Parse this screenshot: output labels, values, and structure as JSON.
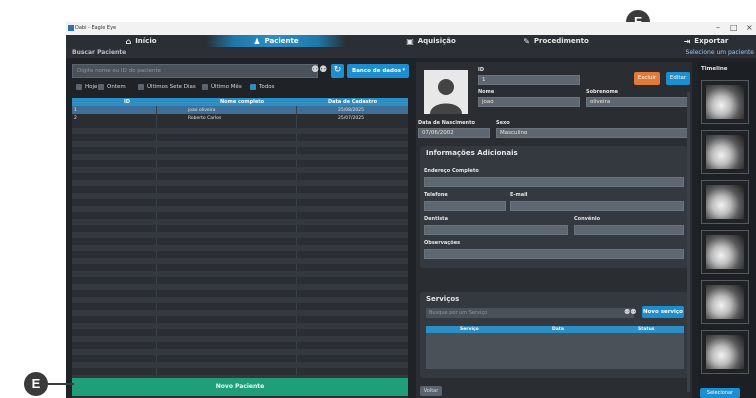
{
  "window": {
    "title": "Dabi - Eagle Eye",
    "min_glyph": "–",
    "max_glyph": "□",
    "close_glyph": "×"
  },
  "nav": {
    "tabs": [
      {
        "label": "Início",
        "icon": "home-icon"
      },
      {
        "label": "Paciente",
        "icon": "person-icon",
        "active": true
      },
      {
        "label": "Aquisição",
        "icon": "acquisition-icon"
      },
      {
        "label": "Procedimento",
        "icon": "edit-icon"
      },
      {
        "label": "Exportar",
        "icon": "export-icon"
      }
    ],
    "icons": {
      "home": "⌂",
      "person": "♟",
      "acquisition": "▣",
      "edit": "✎",
      "export": "⇥"
    }
  },
  "subheader": {
    "left": "Buscar Paciente",
    "right": "Selecione um paciente"
  },
  "search": {
    "placeholder": "Digite nome ou ID do paciente",
    "binoculars_glyph": "⚉⚉",
    "refresh_glyph": "↻",
    "db_label": "Banco de dados",
    "db_chevron": "▾"
  },
  "filters": [
    {
      "label": "Hoje",
      "checked": false
    },
    {
      "label": "Ontem",
      "checked": false
    },
    {
      "label": "Últimos Sete Dias",
      "checked": false
    },
    {
      "label": "Último Mês",
      "checked": false
    },
    {
      "label": "Todos",
      "checked": true
    }
  ],
  "patients_table": {
    "columns": [
      "ID",
      "Nome completo",
      "Data de Cadastro"
    ],
    "rows": [
      {
        "id": "1",
        "name": "joao oliveira",
        "date": "25/08/2025",
        "selected": true
      },
      {
        "id": "2",
        "name": "Roberto Carlos",
        "date": "25/07/2025",
        "selected": false
      }
    ]
  },
  "buttons": {
    "novo_paciente": "Novo Paciente",
    "excluir": "Excluir",
    "editar": "Editar",
    "novo_servico": "Novo serviço",
    "voltar": "Voltar",
    "selecionar": "Selecionar"
  },
  "patient_form": {
    "id_label": "ID",
    "id_value": "1",
    "nome_label": "Nome",
    "nome_value": "joao",
    "sobrenome_label": "Sobrenome",
    "sobrenome_value": "oliveira",
    "nascimento_label": "Data de Nascimento",
    "nascimento_value": "07/06/2002",
    "sexo_label": "Sexo",
    "sexo_value": "Masculino",
    "info_title": "Informações Adicionais",
    "endereco_label": "Endereço Completo",
    "telefone_label": "Telefone",
    "email_label": "E-mail",
    "dentista_label": "Dentista",
    "convenio_label": "Convênio",
    "observacoes_label": "Observações"
  },
  "servicos": {
    "title": "Serviços",
    "search_placeholder": "Busque por um Serviço",
    "columns": [
      "Serviço",
      "Data",
      "Status"
    ]
  },
  "timeline": {
    "title": "Timeline",
    "thumb_count": 6
  },
  "callouts": {
    "f": "F",
    "e": "E"
  },
  "colors": {
    "accent": "#1d8fd0",
    "danger": "#e07a3a",
    "success": "#1f9e7a",
    "callout": "#3a3a3a"
  }
}
